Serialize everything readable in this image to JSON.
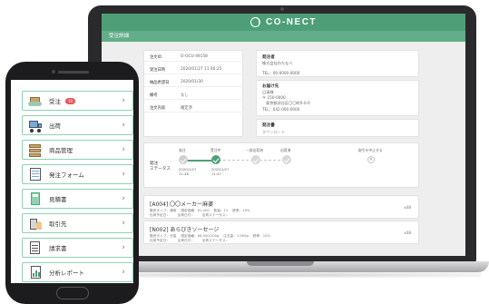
{
  "laptop": {
    "brand": "CO-NECT",
    "section_title": "受注詳細",
    "order_info": [
      {
        "label": "注文ID",
        "value": "O-OCU-49158"
      },
      {
        "label": "受注日時",
        "value": "2020/01/27 11:46:25"
      },
      {
        "label": "納品希望日",
        "value": "2020/01/30"
      },
      {
        "label": "備考",
        "value": "なし"
      },
      {
        "label": "注文内容",
        "value": "確定済"
      }
    ],
    "orderer": {
      "title": "発注者",
      "name": "株式会社わたなべ",
      "tel": "TEL：00-0000-0000"
    },
    "destination": {
      "title": "お届け先",
      "name": "日清様",
      "postal": "〒 150-0000",
      "address": "東京都渋谷区〇〇町0-0-0",
      "tel": "TEL：042-000-0000"
    },
    "invoice": {
      "title": "発注書",
      "link": "ダウンロード"
    },
    "status": {
      "label_line1": "発注",
      "label_line2": "ステータス",
      "steps": [
        {
          "name": "発注",
          "date": "2020/1/27",
          "time": "11:46",
          "state": "done"
        },
        {
          "name": "受注中",
          "date": "2020/1/27",
          "time": "11:47",
          "state": "current"
        },
        {
          "name": "一部出荷済",
          "date": "",
          "time": "",
          "state": "pending"
        },
        {
          "name": "出荷済",
          "date": "",
          "time": "",
          "state": "pending"
        }
      ],
      "cancel_label": "取引を中止する",
      "cancel_symbol": "×"
    },
    "products": [
      {
        "title": "[A004] 〇〇メーカー麻婆",
        "meta1": "販売タイプ：通常　 限定価格：¥1,000　 数量：12　 税率：10%",
        "meta2": "出荷予定日：　　 出荷日付：　　 出荷ステータス：",
        "qty": "x48"
      },
      {
        "title": "[N002] あらびきソーセージ",
        "meta1": "販売タイプ：分量　 限定価格：¥8,000/100g　 注文量：1,000g　 税率：10%",
        "meta2": "出荷予定日：　　 出荷日付：　　 出荷ステータス：",
        "qty": "x48"
      }
    ]
  },
  "phone": {
    "menu": [
      {
        "label": "受注",
        "badge": "10",
        "icon": "package-receive-icon"
      },
      {
        "label": "出荷",
        "badge": "",
        "icon": "truck-icon"
      },
      {
        "label": "商品管理",
        "badge": "",
        "icon": "boxes-icon"
      },
      {
        "label": "発注フォーム",
        "badge": "",
        "icon": "form-icon"
      },
      {
        "label": "見積書",
        "badge": "",
        "icon": "calculator-icon"
      },
      {
        "label": "取引先",
        "badge": "",
        "icon": "building-person-icon"
      },
      {
        "label": "請求書",
        "badge": "",
        "icon": "invoice-icon"
      },
      {
        "label": "分析レポート",
        "badge": "",
        "icon": "report-chart-icon"
      }
    ],
    "chevron": "›"
  },
  "colors": {
    "brand_green": "#4e9f78",
    "menu_border": "#8fd1b3",
    "badge_red": "#e8585a"
  }
}
